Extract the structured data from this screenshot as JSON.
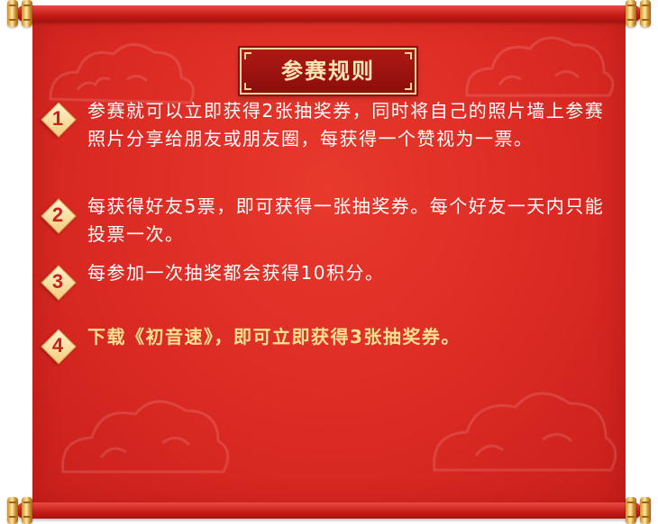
{
  "title": "参赛规则",
  "rules": [
    {
      "marker": "1",
      "text": "参赛就可以立即获得2张抽奖券，同时将自己的照片墙上参赛照片分享给朋友或朋友圈，每获得一个赞视为一票。"
    },
    {
      "marker": "2",
      "text": "每获得好友5票，即可获得一张抽奖券。每个好友一天内只能投票一次。"
    },
    {
      "marker": "3",
      "text": "每参加一次抽奖都会获得10积分。"
    },
    {
      "marker": "4",
      "text": "下载《初音速》，即可立即获得3张抽奖券。"
    }
  ],
  "colors": {
    "background_red": "#db2a23",
    "title_badge": "#9e1411",
    "title_text": "#fbe6b3",
    "rule_text": "#ffffff",
    "highlight_text": "#fbe08f",
    "marker_fill": "#f9e3a8",
    "marker_number": "#c8201a",
    "rod_caps": "#e8b65a"
  }
}
